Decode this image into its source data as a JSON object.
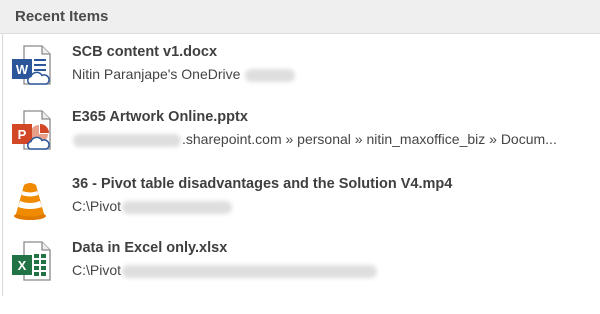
{
  "panel": {
    "title": "Recent Items"
  },
  "items": [
    {
      "title": "SCB content v1.docx",
      "path_prefix": "Nitin Paranjape's OneDrive",
      "path_suffix": "",
      "icon": "word-cloud-icon"
    },
    {
      "title": "E365 Artwork Online.pptx",
      "path_prefix": "",
      "path_suffix": ".sharepoint.com » personal » nitin_maxoffice_biz » Docum...",
      "icon": "powerpoint-cloud-icon"
    },
    {
      "title": "36 - Pivot table disadvantages and the Solution V4.mp4",
      "path_prefix": "C:\\Pivot",
      "path_suffix": "",
      "icon": "vlc-cone-icon"
    },
    {
      "title": "Data in Excel only.xlsx",
      "path_prefix": "C:\\Pivot",
      "path_suffix": "",
      "icon": "excel-icon"
    }
  ],
  "colors": {
    "word": "#2b579a",
    "powerpoint": "#d24726",
    "excel": "#217346",
    "vlc": "#f08a00"
  }
}
